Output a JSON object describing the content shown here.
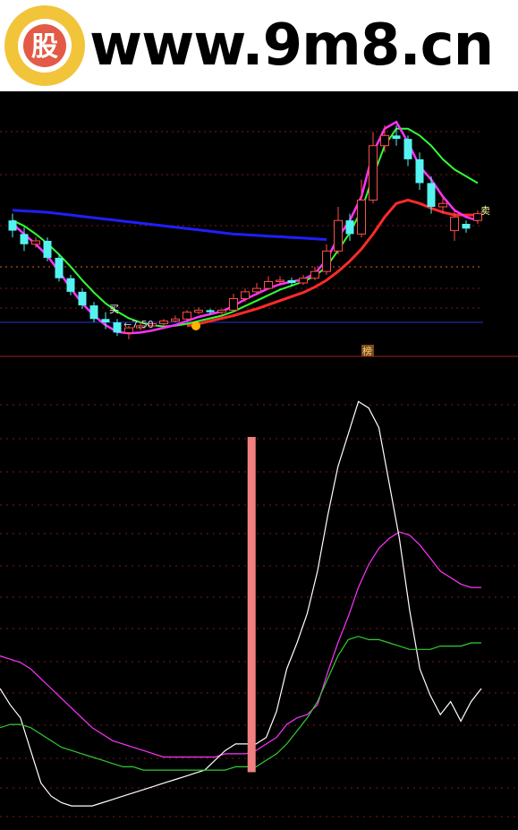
{
  "watermark": {
    "site": "www.9m8.cn",
    "logo_glyph": "股",
    "logo_colors": {
      "ring": "#f2c43a",
      "inner": "#e35a46"
    }
  },
  "upper_panel": {
    "price_label": "←7.50",
    "buy_marker": "买",
    "sell_marker": "卖",
    "top_marker": "榜"
  },
  "colors": {
    "background": "#000000",
    "candle_up": "#ff4d4d",
    "candle_down": "#55f2f2",
    "ma_short": "#ff33ff",
    "ma_mid": "#33ff33",
    "ma_long": "#ff2a2a",
    "ma_very_long": "#1f1fff",
    "indicator_magenta": "#ff33ff",
    "indicator_white": "#ffffff",
    "indicator_green": "#33cc33",
    "bar_signal": "#f08080"
  },
  "chart_data": [
    {
      "type": "candlestick",
      "title": "",
      "price_level_label": "7.50",
      "candles": [
        {
          "o": 8.3,
          "c": 8.15,
          "h": 8.4,
          "l": 8.05,
          "dir": "down"
        },
        {
          "o": 8.1,
          "c": 7.95,
          "h": 8.2,
          "l": 7.85,
          "dir": "down"
        },
        {
          "o": 7.95,
          "c": 8.0,
          "h": 8.05,
          "l": 7.9,
          "dir": "up"
        },
        {
          "o": 8.0,
          "c": 7.75,
          "h": 8.05,
          "l": 7.7,
          "dir": "down"
        },
        {
          "o": 7.75,
          "c": 7.45,
          "h": 7.8,
          "l": 7.4,
          "dir": "down"
        },
        {
          "o": 7.45,
          "c": 7.25,
          "h": 7.5,
          "l": 7.2,
          "dir": "down"
        },
        {
          "o": 7.25,
          "c": 7.05,
          "h": 7.3,
          "l": 7.0,
          "dir": "down"
        },
        {
          "o": 7.05,
          "c": 6.85,
          "h": 7.1,
          "l": 6.8,
          "dir": "down"
        },
        {
          "o": 6.85,
          "c": 6.8,
          "h": 6.95,
          "l": 6.7,
          "dir": "down"
        },
        {
          "o": 6.8,
          "c": 6.65,
          "h": 6.85,
          "l": 6.6,
          "dir": "down"
        },
        {
          "o": 6.65,
          "c": 6.72,
          "h": 6.75,
          "l": 6.55,
          "dir": "up"
        },
        {
          "o": 6.72,
          "c": 6.75,
          "h": 6.8,
          "l": 6.68,
          "dir": "up"
        },
        {
          "o": 6.75,
          "c": 6.78,
          "h": 6.82,
          "l": 6.72,
          "dir": "up"
        },
        {
          "o": 6.78,
          "c": 6.82,
          "h": 6.85,
          "l": 6.75,
          "dir": "up"
        },
        {
          "o": 6.82,
          "c": 6.85,
          "h": 6.9,
          "l": 6.8,
          "dir": "up"
        },
        {
          "o": 6.85,
          "c": 6.95,
          "h": 6.98,
          "l": 6.82,
          "dir": "up"
        },
        {
          "o": 6.95,
          "c": 6.98,
          "h": 7.02,
          "l": 6.92,
          "dir": "up"
        },
        {
          "o": 6.98,
          "c": 6.95,
          "h": 7.0,
          "l": 6.92,
          "dir": "down"
        },
        {
          "o": 6.95,
          "c": 6.98,
          "h": 7.0,
          "l": 6.9,
          "dir": "up"
        },
        {
          "o": 6.98,
          "c": 7.15,
          "h": 7.22,
          "l": 6.95,
          "dir": "up"
        },
        {
          "o": 7.15,
          "c": 7.25,
          "h": 7.3,
          "l": 7.1,
          "dir": "up"
        },
        {
          "o": 7.25,
          "c": 7.3,
          "h": 7.38,
          "l": 7.2,
          "dir": "up"
        },
        {
          "o": 7.3,
          "c": 7.4,
          "h": 7.48,
          "l": 7.28,
          "dir": "up"
        },
        {
          "o": 7.4,
          "c": 7.42,
          "h": 7.48,
          "l": 7.35,
          "dir": "up"
        },
        {
          "o": 7.42,
          "c": 7.38,
          "h": 7.46,
          "l": 7.33,
          "dir": "down"
        },
        {
          "o": 7.38,
          "c": 7.45,
          "h": 7.5,
          "l": 7.35,
          "dir": "up"
        },
        {
          "o": 7.45,
          "c": 7.55,
          "h": 7.62,
          "l": 7.42,
          "dir": "up"
        },
        {
          "o": 7.55,
          "c": 7.85,
          "h": 7.95,
          "l": 7.5,
          "dir": "up"
        },
        {
          "o": 7.85,
          "c": 8.3,
          "h": 8.5,
          "l": 7.8,
          "dir": "up"
        },
        {
          "o": 8.3,
          "c": 8.1,
          "h": 8.4,
          "l": 8.0,
          "dir": "down"
        },
        {
          "o": 8.1,
          "c": 8.6,
          "h": 8.9,
          "l": 8.05,
          "dir": "up"
        },
        {
          "o": 8.6,
          "c": 9.4,
          "h": 9.6,
          "l": 8.55,
          "dir": "up"
        },
        {
          "o": 9.4,
          "c": 9.55,
          "h": 9.7,
          "l": 9.3,
          "dir": "up"
        },
        {
          "o": 9.55,
          "c": 9.5,
          "h": 9.7,
          "l": 9.4,
          "dir": "down"
        },
        {
          "o": 9.5,
          "c": 9.2,
          "h": 9.55,
          "l": 9.1,
          "dir": "down"
        },
        {
          "o": 9.2,
          "c": 8.85,
          "h": 9.3,
          "l": 8.75,
          "dir": "down"
        },
        {
          "o": 8.85,
          "c": 8.5,
          "h": 8.95,
          "l": 8.4,
          "dir": "down"
        },
        {
          "o": 8.5,
          "c": 8.55,
          "h": 8.65,
          "l": 8.4,
          "dir": "up"
        },
        {
          "o": 8.35,
          "c": 8.15,
          "h": 8.45,
          "l": 8.0,
          "dir": "up"
        },
        {
          "o": 8.25,
          "c": 8.18,
          "h": 8.3,
          "l": 8.12,
          "dir": "down"
        },
        {
          "o": 8.3,
          "c": 8.4,
          "h": 8.45,
          "l": 8.25,
          "dir": "up"
        }
      ],
      "ma_short": [
        8.25,
        8.1,
        7.95,
        7.78,
        7.55,
        7.3,
        7.08,
        6.9,
        6.76,
        6.66,
        6.64,
        6.65,
        6.68,
        6.72,
        6.76,
        6.82,
        6.88,
        6.92,
        6.96,
        7.04,
        7.14,
        7.22,
        7.3,
        7.36,
        7.4,
        7.43,
        7.52,
        7.72,
        8.05,
        8.3,
        8.65,
        9.3,
        9.65,
        9.75,
        9.45,
        9.1,
        8.9,
        8.65,
        8.45,
        8.35,
        8.3
      ],
      "ma_mid": [
        8.3,
        8.22,
        8.1,
        7.96,
        7.8,
        7.62,
        7.42,
        7.24,
        7.08,
        6.96,
        6.86,
        6.8,
        6.76,
        6.74,
        6.75,
        6.78,
        6.82,
        6.86,
        6.9,
        6.96,
        7.04,
        7.12,
        7.2,
        7.28,
        7.34,
        7.4,
        7.48,
        7.62,
        7.86,
        8.12,
        8.45,
        8.95,
        9.4,
        9.65,
        9.65,
        9.55,
        9.4,
        9.2,
        9.05,
        8.95,
        8.85
      ],
      "ma_long": [
        null,
        null,
        null,
        null,
        null,
        null,
        null,
        null,
        null,
        null,
        null,
        null,
        null,
        null,
        null,
        6.75,
        6.78,
        6.82,
        6.86,
        6.9,
        6.95,
        7.0,
        7.06,
        7.12,
        7.18,
        7.24,
        7.32,
        7.42,
        7.55,
        7.7,
        7.88,
        8.1,
        8.35,
        8.55,
        8.6,
        8.55,
        8.48,
        8.42,
        8.38,
        8.38,
        8.38
      ],
      "ma_very_long": [
        8.45,
        8.44,
        8.43,
        8.42,
        8.4,
        8.38,
        8.36,
        8.34,
        8.32,
        8.3,
        8.28,
        8.26,
        8.24,
        8.22,
        8.2,
        8.18,
        8.16,
        8.14,
        8.12,
        8.1,
        8.09,
        8.08,
        8.07,
        8.06,
        8.05,
        8.04,
        8.03,
        8.02
      ],
      "ylim": [
        6.3,
        10.2
      ]
    },
    {
      "type": "line",
      "title": "",
      "series": [
        {
          "color": "#ff33ff",
          "values": [
            52,
            51,
            50,
            48,
            45,
            42,
            39,
            36,
            33,
            30,
            28,
            26,
            25,
            24,
            23,
            22,
            21,
            21,
            21,
            21,
            21,
            21,
            22,
            22,
            22,
            23,
            25,
            27,
            31,
            33,
            34,
            37,
            47,
            56,
            64,
            73,
            80,
            85,
            88,
            90,
            89,
            86,
            82,
            78,
            76,
            74,
            73,
            73
          ]
        },
        {
          "color": "#ffffff",
          "values": [
            42,
            37,
            33,
            23,
            13,
            9,
            7,
            6,
            6,
            6,
            7,
            8,
            9,
            10,
            11,
            12,
            13,
            14,
            15,
            16,
            17,
            20,
            23,
            25,
            25,
            25,
            27,
            35,
            48,
            56,
            65,
            78,
            95,
            110,
            120,
            130,
            128,
            122,
            105,
            88,
            66,
            48,
            40,
            34,
            38,
            32,
            38,
            42
          ]
        },
        {
          "color": "#33cc33",
          "values": [
            30,
            31,
            31,
            30,
            28,
            26,
            24,
            23,
            22,
            21,
            20,
            19,
            18,
            18,
            17,
            17,
            17,
            17,
            17,
            17,
            17,
            17,
            17,
            18,
            18,
            18,
            20,
            22,
            25,
            29,
            33,
            38,
            45,
            52,
            57,
            58,
            57,
            57,
            56,
            55,
            54,
            54,
            54,
            55,
            55,
            55,
            56,
            56
          ]
        }
      ],
      "bar": {
        "position_index": 24,
        "color": "#f08080"
      },
      "ylim": [
        0,
        140
      ]
    }
  ]
}
